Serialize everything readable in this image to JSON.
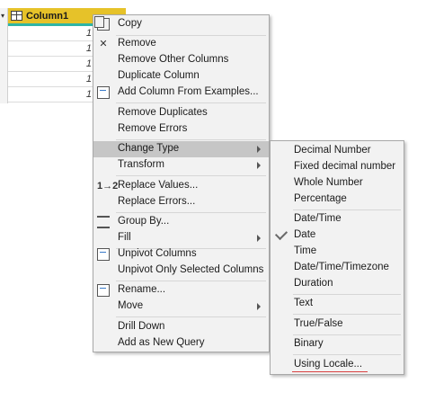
{
  "grid": {
    "column_header": "Column1",
    "row_values": [
      "1",
      "1",
      "1",
      "1",
      "1"
    ]
  },
  "main_menu": {
    "items": [
      {
        "label": "Copy",
        "icon": "copy-icon"
      },
      {
        "label": "Remove",
        "icon": "remove-icon"
      },
      {
        "label": "Remove Other Columns",
        "icon": ""
      },
      {
        "label": "Duplicate Column",
        "icon": ""
      },
      {
        "label": "Add Column From Examples...",
        "icon": "add-column-examples-icon"
      },
      {
        "label": "Remove Duplicates",
        "icon": ""
      },
      {
        "label": "Remove Errors",
        "icon": ""
      },
      {
        "label": "Change Type",
        "icon": "",
        "submenu": true
      },
      {
        "label": "Transform",
        "icon": "",
        "submenu": true
      },
      {
        "label": "Replace Values...",
        "icon": "replace-values-icon"
      },
      {
        "label": "Replace Errors...",
        "icon": ""
      },
      {
        "label": "Group By...",
        "icon": "group-by-icon"
      },
      {
        "label": "Fill",
        "icon": "",
        "submenu": true
      },
      {
        "label": "Unpivot Columns",
        "icon": "unpivot-icon"
      },
      {
        "label": "Unpivot Only Selected Columns",
        "icon": ""
      },
      {
        "label": "Rename...",
        "icon": "rename-icon"
      },
      {
        "label": "Move",
        "icon": "",
        "submenu": true
      },
      {
        "label": "Drill Down",
        "icon": ""
      },
      {
        "label": "Add as New Query",
        "icon": ""
      }
    ]
  },
  "change_type_menu": {
    "items": [
      {
        "label": "Decimal Number"
      },
      {
        "label": "Fixed decimal number"
      },
      {
        "label": "Whole Number"
      },
      {
        "label": "Percentage"
      },
      {
        "label": "Date/Time"
      },
      {
        "label": "Date",
        "checked": true
      },
      {
        "label": "Time"
      },
      {
        "label": "Date/Time/Timezone"
      },
      {
        "label": "Duration"
      },
      {
        "label": "Text"
      },
      {
        "label": "True/False"
      },
      {
        "label": "Binary"
      },
      {
        "label": "Using Locale..."
      }
    ]
  },
  "colors": {
    "column_header_bg": "#e6c229",
    "column_header_underline": "#2fb5a5",
    "highlight": "#c6c6c6",
    "menu_bg": "#f2f2f2"
  }
}
